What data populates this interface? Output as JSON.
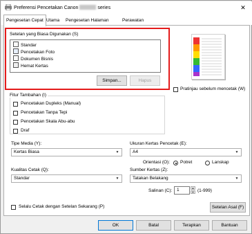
{
  "window": {
    "title_prefix": "Preferensi Pencetakan Canon",
    "title_suffix": "series",
    "close_label": "✕"
  },
  "tabs": [
    {
      "label": "Pengesetan Cepat"
    },
    {
      "label": "Utama"
    },
    {
      "label": "Pengesetan Halaman"
    },
    {
      "label": "Perawatan"
    }
  ],
  "common_settings": {
    "label": "Setelan yang Biasa Digunakan (S)",
    "items": [
      {
        "label": "Standar"
      },
      {
        "label": "Pencetakan Foto"
      },
      {
        "label": "Dokumen Bisnis"
      },
      {
        "label": "Hemat Kertas"
      }
    ],
    "save_label": "Simpan...",
    "delete_label": "Hapus"
  },
  "preview": {
    "checkbox_label": "Pratinjau sebelum mencetak (W)"
  },
  "additional_features": {
    "label": "Fitur Tambahan (I)",
    "options": [
      {
        "label": "Pencetakan Dupleks (Manual)"
      },
      {
        "label": "Pencetakan Tanpa Tepi"
      },
      {
        "label": "Pencetakan Skala Abu-abu"
      },
      {
        "label": "Draf"
      }
    ]
  },
  "media_type": {
    "label": "Tipe Media (Y):",
    "value": "Kertas Biasa"
  },
  "paper_size": {
    "label": "Ukuran Kertas Pencetak (E):",
    "value": "A4"
  },
  "orientation": {
    "label": "Orientasi (O):",
    "portrait_label": "Potret",
    "landscape_label": "Lanskap"
  },
  "print_quality": {
    "label": "Kualitas Cetak (Q):",
    "value": "Standar"
  },
  "paper_source": {
    "label": "Sumber Kertas (Z):",
    "value": "Tatakan Belakang"
  },
  "copies": {
    "label": "Salinan (C):",
    "value": "1",
    "range": "(1-999)"
  },
  "always_print": {
    "label": "Selalu Cetak dengan Setelan Sekarang (P)"
  },
  "defaults_label": "Setelan Asal (F)",
  "footer": {
    "ok": "OK",
    "cancel": "Batal",
    "apply": "Terapkan",
    "help": "Bantuan"
  }
}
